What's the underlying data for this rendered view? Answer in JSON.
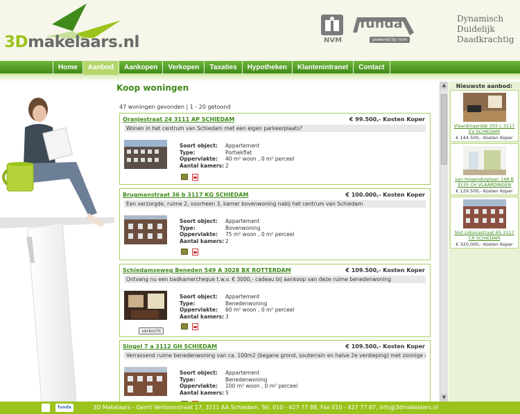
{
  "header": {
    "logo_prefix": "3D",
    "logo_main": "makelaars.nl",
    "nvm_label": "NVM",
    "funda_label": "funda",
    "funda_powered": "powered by nvm",
    "tagline": [
      "Dynamisch",
      "Duidelijk",
      "Daadkrachtig"
    ]
  },
  "nav": {
    "items": [
      "Home",
      "Aanbod",
      "Aankopen",
      "Verkopen",
      "Taxaties",
      "Hypotheken",
      "Klantenintranet",
      "Contact"
    ],
    "active": "Aanbod"
  },
  "main": {
    "title": "Koop woningen",
    "result_count": "47 woningen gevonden | 1 - 20 getoond",
    "labels": {
      "type_object": "Soort object:",
      "type": "Type:",
      "area": "Oppervlakte:",
      "rooms": "Aantal kamers:"
    },
    "listings": [
      {
        "title": "Oranjestraat 24 3111 AP SCHIEDAM",
        "price": "€ 99.500,- Kosten Koper",
        "description": "Wonen in het centrum van Schiedam met een eigen parkeerplaats?",
        "object_type": "Appartement",
        "type": "Portiekflat",
        "area": "40 m² woon , 0 m² perceel",
        "rooms": "2",
        "badge": ""
      },
      {
        "title": "Brugmanstraat 36 b 3117 KG SCHIEDAM",
        "price": "€ 100.000,- Kosten Koper",
        "description": "Een verzorgde, ruime 2, voorheen 3, kamer bovenwoning nabij het centrum van Schiedam",
        "object_type": "Appartement",
        "type": "Bovenwoning",
        "area": "75 m² woon , 0 m² perceel",
        "rooms": "2",
        "badge": ""
      },
      {
        "title": "Schiedamseweg Beneden 549 A 3028 BX ROTTERDAM",
        "price": "€ 109.500,- Kosten Koper",
        "description": "Ontvang nu een badkamercheque t.w.v. € 3000,- cadeau bij aankoop van deze ruime benedenwoning",
        "object_type": "Appartement",
        "type": "Benedenwoning",
        "area": "60 m² woon , 0 m² perceel",
        "rooms": "3",
        "badge": "verkocht"
      },
      {
        "title": "Singel 7 a 3112 GH SCHIEDAM",
        "price": "€ 109.500,- Kosten Koper",
        "description": "Verrassend ruime benedenwoning van ca. 100m2 (begane grond, souterrain en halve 2e verdieping) met zonnige achtertuin",
        "object_type": "Appartement",
        "type": "Benedenwoning",
        "area": "100 m² woon , 0 m² perceel",
        "rooms": "5",
        "badge": ""
      }
    ]
  },
  "sidebar": {
    "title": "Nieuwste aanbod:",
    "items": [
      {
        "address": "Vlaardingerdijk 355 c 3117 EV SCHIEDAM",
        "price": "€ 144.500,- Kosten Koper"
      },
      {
        "address": "van Hogendorplaan 148 B 3135 CH VLAARDINGEN",
        "price": "€ 129.500,- Kosten Koper"
      },
      {
        "address": "Sint Liduinastraat 65 3117 CR SCHIEDAM",
        "price": "€ 320.000,- Kosten Koper"
      }
    ]
  },
  "footer": {
    "funda_small": "funda",
    "text": "3D Makelaars - Gerrit Verboonstraat 17, 3111 AA Schiedam.   Tel. 010 - 427 77 88,   Fax 010 - 427 77 87,   info@3dmakelaars.nl"
  },
  "colors": {
    "brand_green": "#3f8a1a",
    "accent_green": "#9bc31c",
    "nav_active": "#b5d66c"
  }
}
